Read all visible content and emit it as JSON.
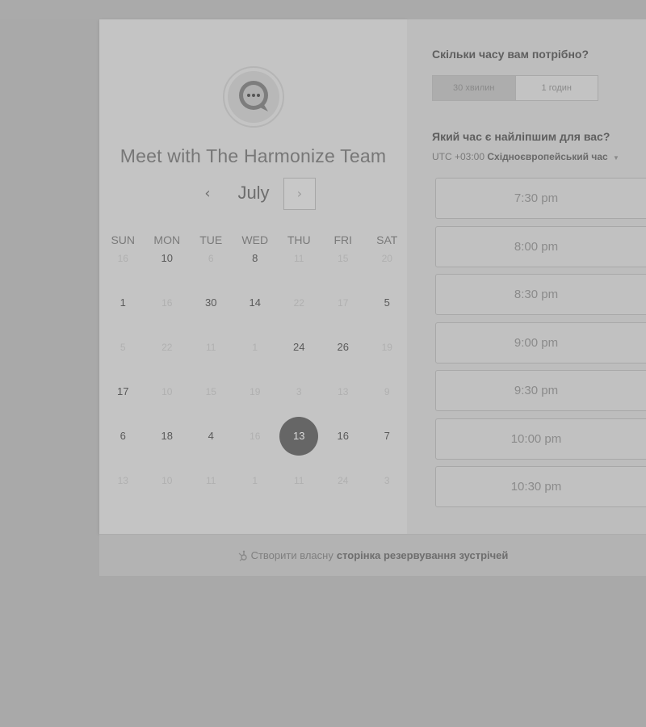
{
  "scheduler": {
    "title": "Meet with The Harmonize Team",
    "avatar_icon": "chat-bubble-icon",
    "calendar": {
      "month": "July",
      "prev_icon": "‹",
      "next_icon": "›",
      "weekdays": [
        "SUN",
        "MON",
        "TUE",
        "WED",
        "THU",
        "FRI",
        "SAT"
      ],
      "weeks": [
        [
          {
            "d": "16",
            "s": "dim"
          },
          {
            "d": "10",
            "s": "avail"
          },
          {
            "d": "6",
            "s": "dim"
          },
          {
            "d": "8",
            "s": "avail"
          },
          {
            "d": "11",
            "s": "dim"
          },
          {
            "d": "15",
            "s": "dim"
          },
          {
            "d": "20",
            "s": "dim"
          }
        ],
        [
          {
            "d": "1",
            "s": "avail"
          },
          {
            "d": "16",
            "s": "dim"
          },
          {
            "d": "30",
            "s": "avail"
          },
          {
            "d": "14",
            "s": "avail"
          },
          {
            "d": "22",
            "s": "dim"
          },
          {
            "d": "17",
            "s": "dim"
          },
          {
            "d": "5",
            "s": "avail"
          }
        ],
        [
          {
            "d": "5",
            "s": "dim"
          },
          {
            "d": "22",
            "s": "dim"
          },
          {
            "d": "11",
            "s": "dim"
          },
          {
            "d": "1",
            "s": "dim"
          },
          {
            "d": "24",
            "s": "avail"
          },
          {
            "d": "26",
            "s": "avail"
          },
          {
            "d": "19",
            "s": "dim"
          }
        ],
        [
          {
            "d": "17",
            "s": "avail"
          },
          {
            "d": "10",
            "s": "dim"
          },
          {
            "d": "15",
            "s": "dim"
          },
          {
            "d": "19",
            "s": "dim"
          },
          {
            "d": "3",
            "s": "dim"
          },
          {
            "d": "13",
            "s": "dim"
          },
          {
            "d": "9",
            "s": "dim"
          }
        ],
        [
          {
            "d": "6",
            "s": "avail"
          },
          {
            "d": "18",
            "s": "avail"
          },
          {
            "d": "4",
            "s": "avail"
          },
          {
            "d": "16",
            "s": "dim"
          },
          {
            "d": "13",
            "s": "sel"
          },
          {
            "d": "16",
            "s": "avail"
          },
          {
            "d": "7",
            "s": "avail"
          }
        ],
        [
          {
            "d": "13",
            "s": "dim"
          },
          {
            "d": "10",
            "s": "dim"
          },
          {
            "d": "11",
            "s": "dim"
          },
          {
            "d": "1",
            "s": "dim"
          },
          {
            "d": "11",
            "s": "dim"
          },
          {
            "d": "24",
            "s": "dim"
          },
          {
            "d": "3",
            "s": "dim"
          }
        ]
      ]
    },
    "duration_question": "Скільки часу вам потрібно?",
    "durations": [
      {
        "label": "30 хвилин",
        "active": true
      },
      {
        "label": "1 годин",
        "active": false
      }
    ],
    "time_question": "Який час є найліпшим для вас?",
    "timezone": {
      "offset": "UTC +03:00",
      "name": "Східноєвропейський час"
    },
    "time_slots": [
      "7:30 pm",
      "8:00 pm",
      "8:30 pm",
      "9:00 pm",
      "9:30 pm",
      "10:00 pm",
      "10:30 pm"
    ],
    "footer": {
      "prefix": "Створити власну",
      "link": "сторінка резервування зустрічей",
      "icon": "hubspot-sprocket-icon"
    }
  }
}
